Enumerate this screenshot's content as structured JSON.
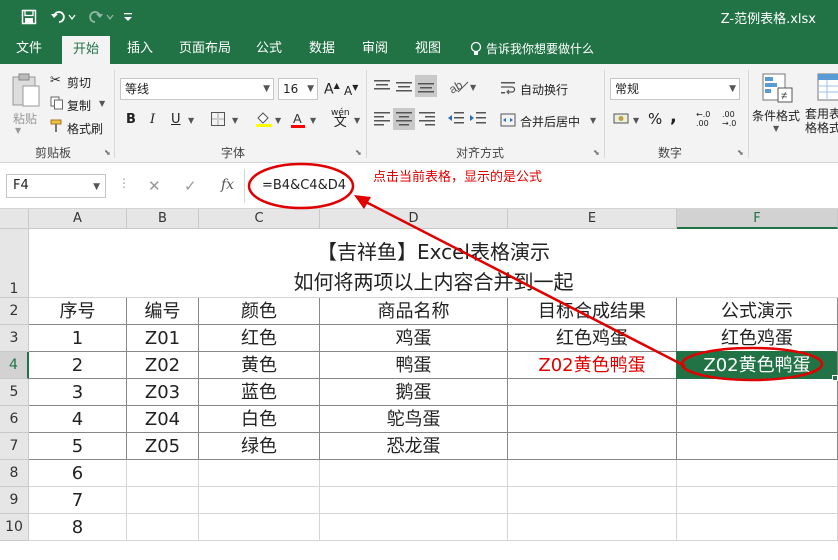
{
  "window": {
    "title": "Z-范例表格.xlsx"
  },
  "tabs": [
    "文件",
    "开始",
    "插入",
    "页面布局",
    "公式",
    "数据",
    "审阅",
    "视图",
    "告诉我你想要做什么"
  ],
  "ribbon": {
    "clipboard": {
      "paste": "粘贴",
      "cut": "剪切",
      "copy": "复制",
      "format_painter": "格式刷",
      "label": "剪贴板"
    },
    "font": {
      "name": "等线",
      "size": "16",
      "bold": "B",
      "italic": "I",
      "underline": "U",
      "grow": "A",
      "shrink": "A",
      "phonetic": "wén",
      "label": "字体"
    },
    "alignment": {
      "wrap": "自动换行",
      "merge": "合并后居中",
      "label": "对齐方式"
    },
    "number": {
      "format": "常规",
      "percent": "%",
      "comma": ",",
      "label": "数字"
    },
    "styles": {
      "conditional": "条件格式",
      "table": "套用表格格式"
    }
  },
  "formula_bar": {
    "cell_ref": "F4",
    "formula": "=B4&C4&D4",
    "fx": "fx",
    "cancel": "✕",
    "enter": "✓"
  },
  "annotation": "点击当前表格，显示的是公式",
  "columns": [
    "A",
    "B",
    "C",
    "D",
    "E",
    "F"
  ],
  "rows": [
    "1",
    "2",
    "3",
    "4",
    "5",
    "6",
    "7",
    "8",
    "9",
    "10"
  ],
  "sheet": {
    "title_line1": "【吉祥鱼】Excel表格演示",
    "title_line2": "如何将两项以上内容合并到一起",
    "headers": [
      "序号",
      "编号",
      "颜色",
      "商品名称",
      "目标合成结果",
      "公式演示"
    ],
    "data": [
      [
        "1",
        "Z01",
        "红色",
        "鸡蛋",
        "红色鸡蛋",
        "红色鸡蛋"
      ],
      [
        "2",
        "Z02",
        "黄色",
        "鸭蛋",
        "Z02黄色鸭蛋",
        "Z02黄色鸭蛋"
      ],
      [
        "3",
        "Z03",
        "蓝色",
        "鹅蛋",
        "",
        ""
      ],
      [
        "4",
        "Z04",
        "白色",
        "鸵鸟蛋",
        "",
        ""
      ],
      [
        "5",
        "Z05",
        "绿色",
        "恐龙蛋",
        "",
        ""
      ],
      [
        "6",
        "",
        "",
        "",
        "",
        ""
      ],
      [
        "7",
        "",
        "",
        "",
        "",
        ""
      ],
      [
        "8",
        "",
        "",
        "",
        "",
        ""
      ]
    ]
  },
  "colors": {
    "accent": "#217346",
    "annotation": "#e00000"
  }
}
